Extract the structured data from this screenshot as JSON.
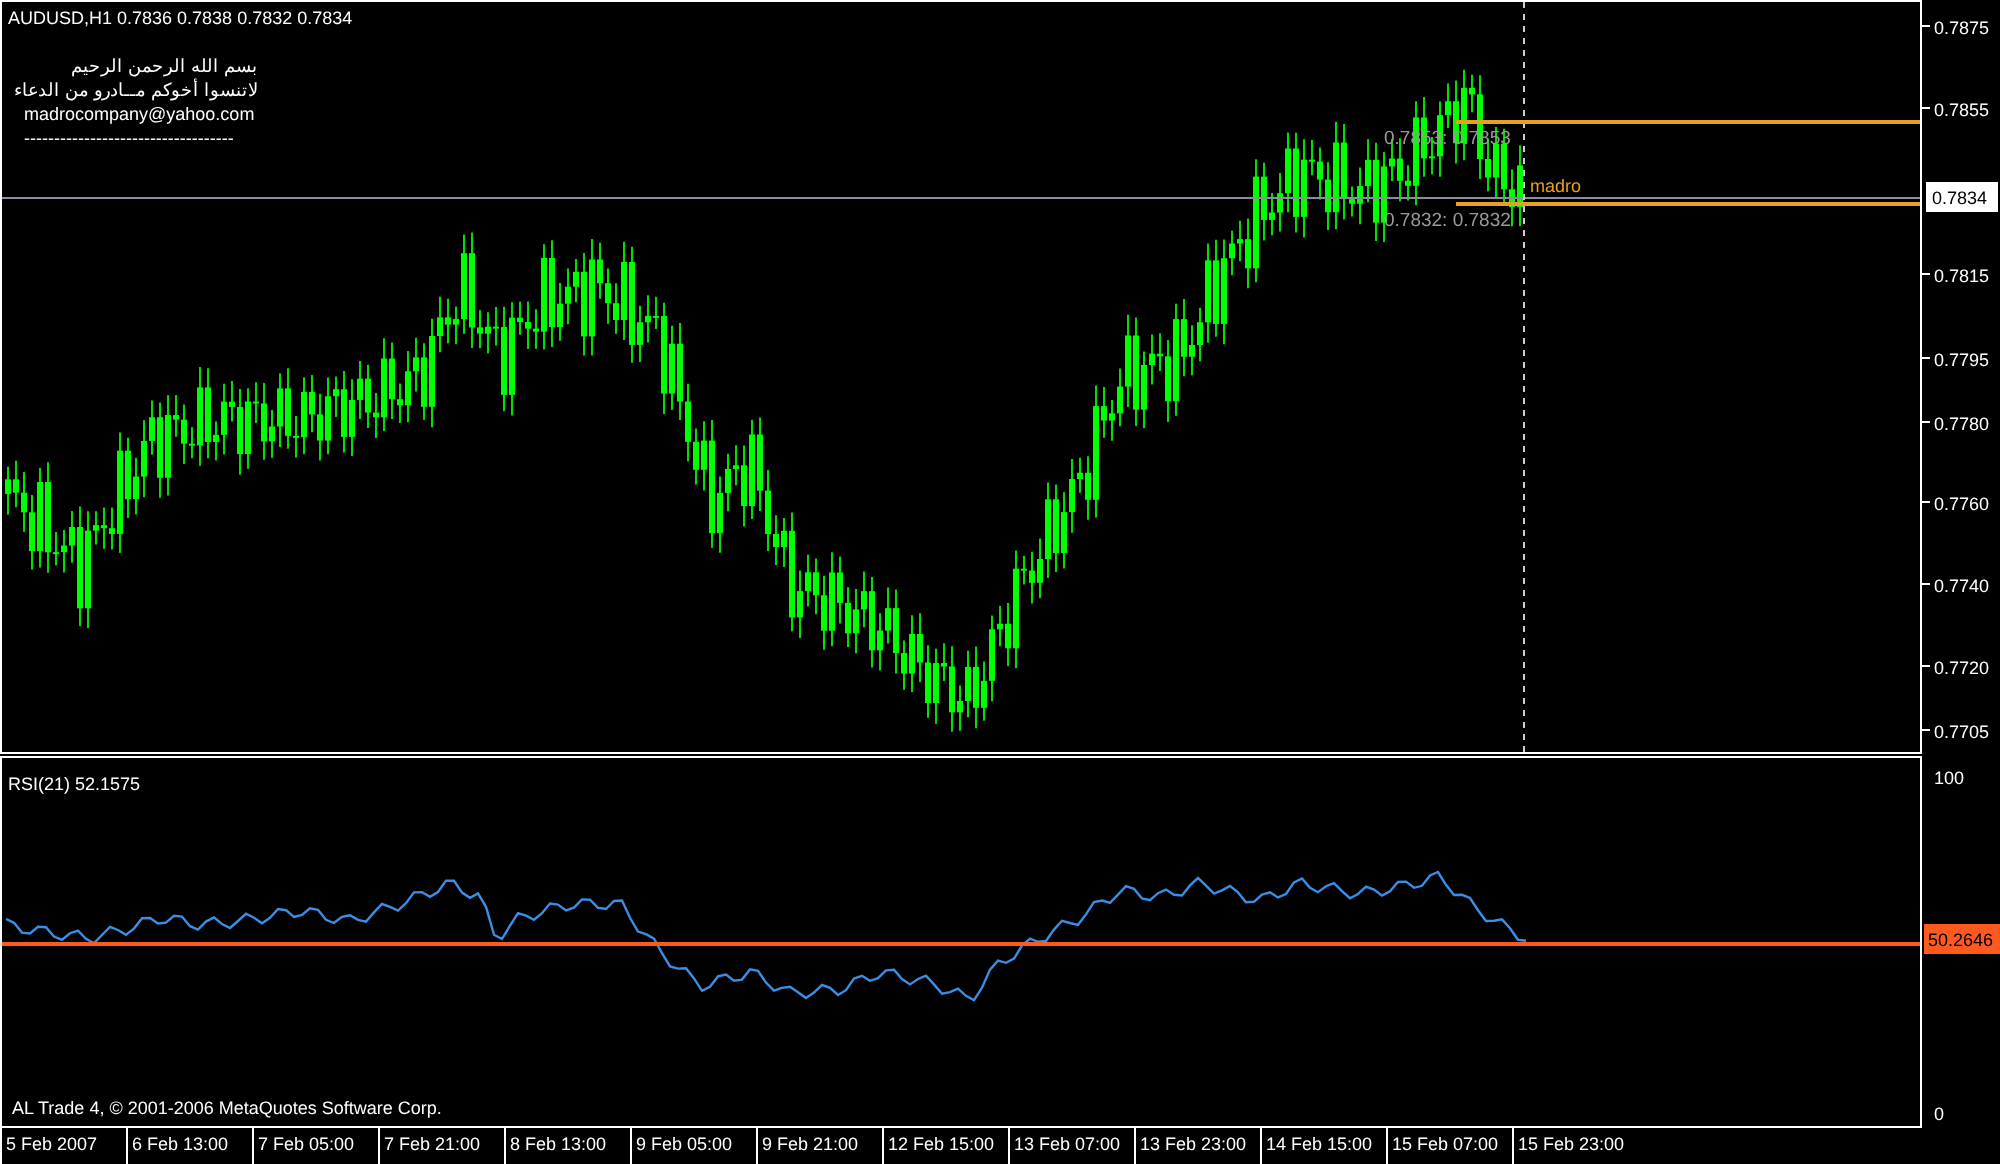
{
  "chart": {
    "title": "AUDUSD,H1  0.7836 0.7838 0.7832 0.7834",
    "notes": [
      "بسم الله الرحمن الرحيم",
      "لاتنسوا أخوكم مــادرو من الدعاء",
      "madrocompany@yahoo.com",
      "-----------------------------------"
    ],
    "price_labels": [
      "0.7875",
      "0.7855",
      "0.7815",
      "0.7795",
      "0.7780",
      "0.7760",
      "0.7740",
      "0.7720",
      "0.7705"
    ],
    "current_price": "0.7834",
    "line_labels": [
      "0.7853: 0.7853",
      "0.7832: 0.7832"
    ],
    "marker_label": "madro"
  },
  "indicator": {
    "title": "RSI(21) 52.1575",
    "scale_labels": [
      "100",
      "0"
    ],
    "level_label": "50.2646"
  },
  "copyright": "AL Trade 4, © 2001-2006 MetaQuotes Software Corp.",
  "time_labels": [
    "5 Feb 2007",
    "6 Feb 13:00",
    "7 Feb 05:00",
    "7 Feb 21:00",
    "8 Feb 13:00",
    "9 Feb 05:00",
    "9 Feb 21:00",
    "12 Feb 15:00",
    "13 Feb 07:00",
    "13 Feb 23:00",
    "14 Feb 15:00",
    "15 Feb 07:00",
    "15 Feb 23:00"
  ]
}
